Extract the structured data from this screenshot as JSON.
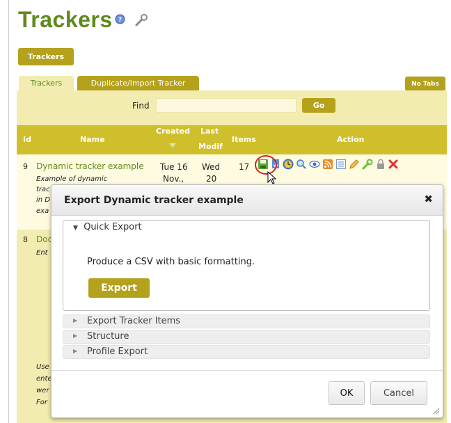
{
  "page": {
    "title": "Trackers"
  },
  "icons": {
    "help": "help-icon",
    "admin": "wrench-icon"
  },
  "toolbar": {
    "trackers_button": "Trackers"
  },
  "tabs": [
    {
      "label": "Trackers"
    },
    {
      "label": "Duplicate/Import Tracker"
    }
  ],
  "no_tabs": "No Tabs",
  "find": {
    "label": "Find",
    "value": "",
    "go": "Go"
  },
  "table": {
    "headers": {
      "id": "Id",
      "name": "Name",
      "created": "Created",
      "last": "Last",
      "modif": "Modif",
      "items": "Items",
      "action": "Action"
    },
    "rows": [
      {
        "id": "9",
        "name": "Dynamic tracker example",
        "description_lines": [
          "Example of dynamic",
          "trac",
          "in D",
          "exa"
        ],
        "created_day": "Tue 16",
        "created_month": "Nov.,",
        "modified_day": "Wed",
        "modified_date": "20",
        "items": "17"
      },
      {
        "id": "8",
        "name": "Doc",
        "description_lines": [
          "Ent",
          "Use",
          "ente",
          "wer",
          "For"
        ]
      }
    ]
  },
  "action_icons": [
    "save-icon",
    "import-icon",
    "clock-icon",
    "search-icon",
    "eye-icon",
    "rss-icon",
    "list-icon",
    "pencil-icon",
    "wrench-icon",
    "lock-icon",
    "delete-icon"
  ],
  "dialog": {
    "title": "Export Dynamic tracker example",
    "close": "✖",
    "sections": [
      {
        "label": "Quick Export",
        "open": true,
        "description": "Produce a CSV with basic formatting.",
        "button": "Export"
      },
      {
        "label": "Export Tracker Items",
        "open": false
      },
      {
        "label": "Structure",
        "open": false
      },
      {
        "label": "Profile Export",
        "open": false
      }
    ],
    "ok": "OK",
    "cancel": "Cancel"
  },
  "colors": {
    "brand_green": "#5f8a1c",
    "olive": "#b4a11c",
    "header_olive": "#d0bf2c",
    "panel": "#f2ecb0",
    "highlight": "#d62020"
  }
}
